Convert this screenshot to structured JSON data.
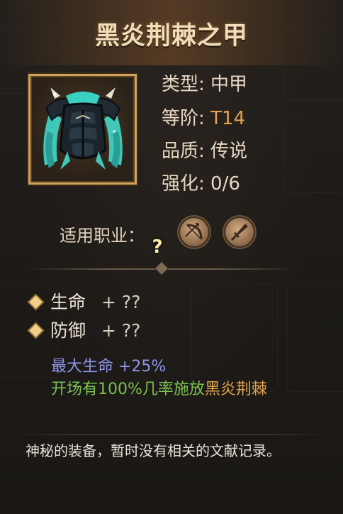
{
  "item": {
    "name": "黑炎荆棘之甲",
    "type_label": "类型:",
    "type_value": "中甲",
    "tier_label": "等阶:",
    "tier_value": "T14",
    "quality_label": "品质:",
    "quality_value": "传说",
    "enhance_label": "强化:",
    "enhance_value": "0/6",
    "help_glyph": "?",
    "icon": "dark-armor-icon"
  },
  "classes": {
    "label": "适用职业：",
    "icons": [
      "bow-class-icon",
      "dagger-class-icon"
    ]
  },
  "attributes": [
    {
      "name": "生命",
      "value": "+ ??"
    },
    {
      "name": "防御",
      "value": "+ ??"
    }
  ],
  "bonuses": {
    "max_hp": "最大生命 +25%",
    "skill_prefix": "开场有100%几率施放",
    "skill_name": "黑炎荆棘"
  },
  "description": "神秘的装备，暂时没有相关的文献记录。",
  "colors": {
    "title": "#f1ddb7",
    "frame_gold": "#d3a25a",
    "tier_orange": "#e5a050",
    "bonus_blue": "#8d95e8",
    "bonus_green": "#79c050",
    "skill_orange": "#e2a34c"
  }
}
